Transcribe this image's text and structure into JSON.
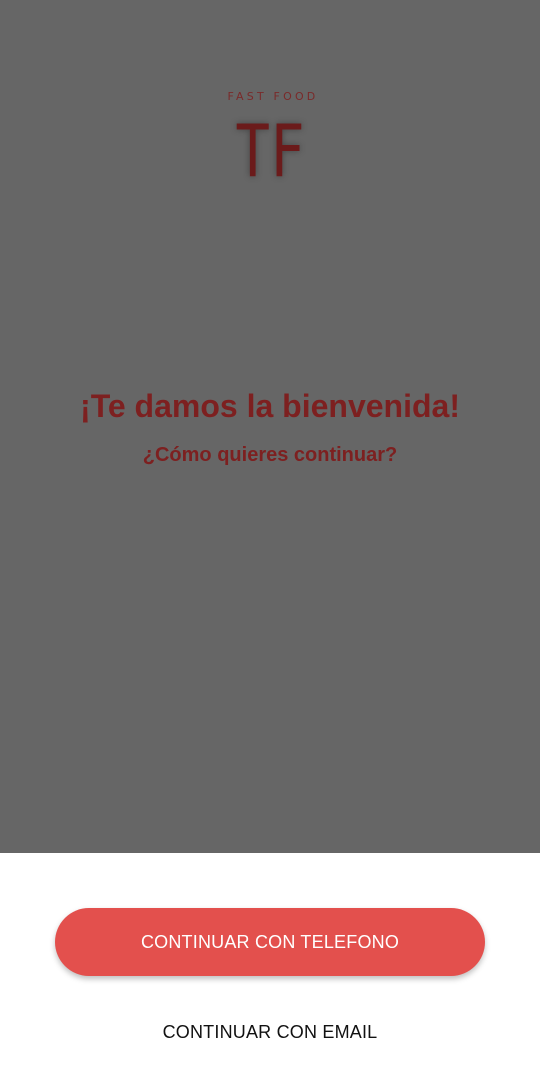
{
  "brand": {
    "tagline": "FAST FOOD",
    "logo_text": "TF"
  },
  "welcome": {
    "title": "¡Te damos la bienvenida!",
    "subtitle": "¿Cómo quieres continuar?"
  },
  "actions": {
    "phone_label": "CONTINUAR CON TELEFONO",
    "email_label": "CONTINUAR CON EMAIL"
  },
  "colors": {
    "overlay": "#666666",
    "brand_red": "#7d2020",
    "primary_button": "#e3504d",
    "sheet_background": "#ffffff"
  }
}
